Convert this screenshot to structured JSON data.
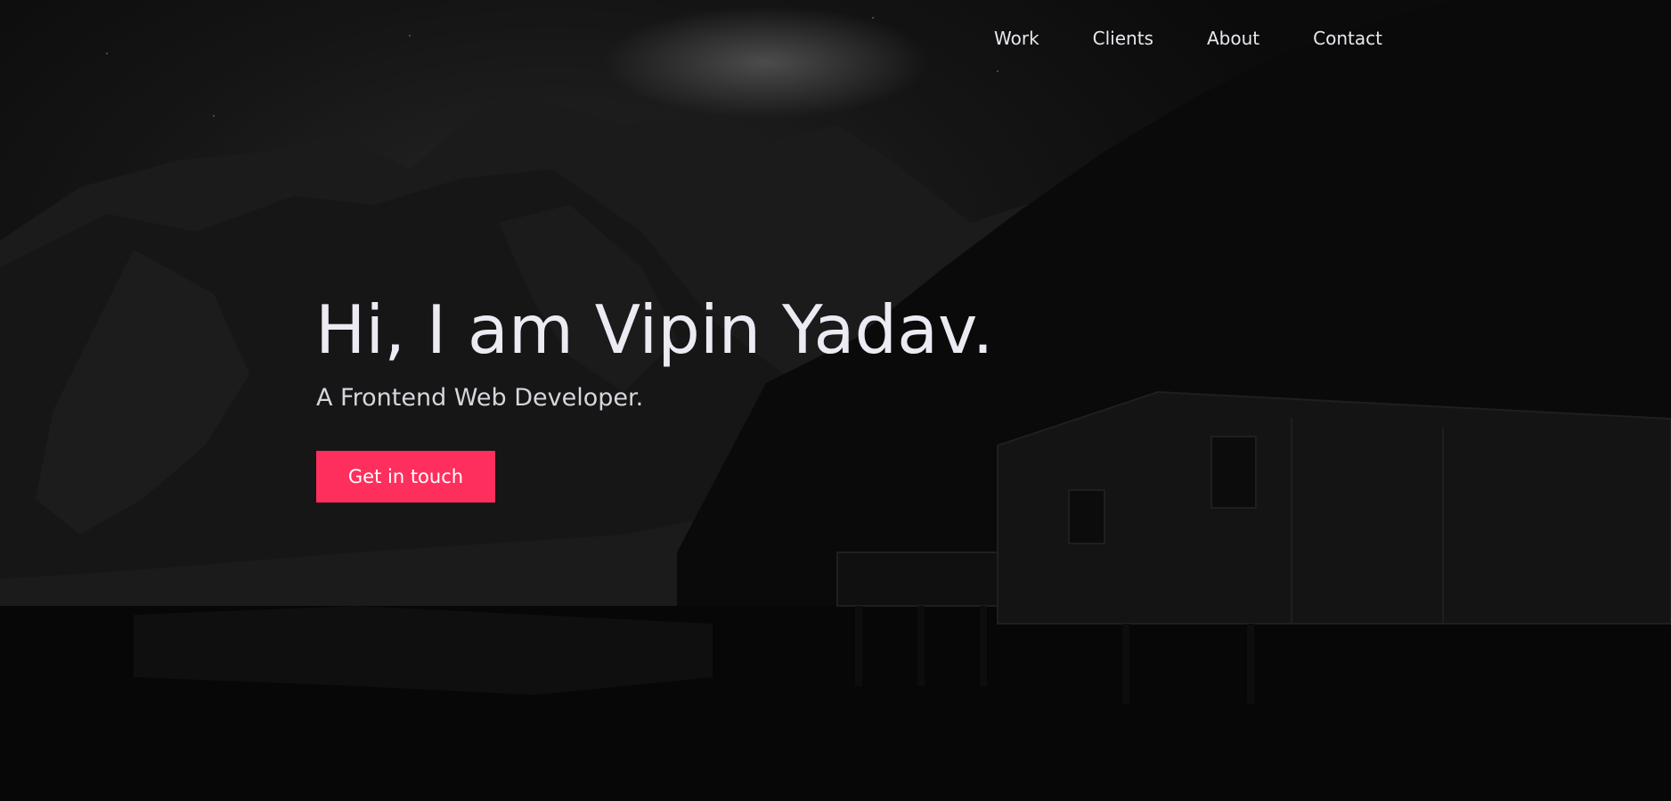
{
  "nav": {
    "items": [
      {
        "label": "Work"
      },
      {
        "label": "Clients"
      },
      {
        "label": "About"
      },
      {
        "label": "Contact"
      }
    ]
  },
  "hero": {
    "headline": "Hi, I am Vipin Yadav.",
    "subheadline": "A Frontend Web Developer.",
    "cta_label": "Get in touch"
  },
  "colors": {
    "accent": "#fe2f5d",
    "text_primary": "#ecebf3",
    "background": "#0b0b0b"
  }
}
